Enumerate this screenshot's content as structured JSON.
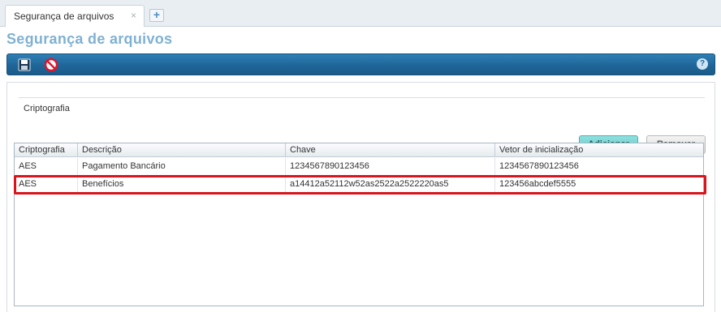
{
  "tabs": [
    {
      "label": "Segurança de arquivos",
      "close": "×"
    }
  ],
  "tab_add_label": "+",
  "page_title": "Segurança de arquivos",
  "toolbar": {
    "save_icon": "save-icon",
    "cancel_icon": "cancel-icon",
    "help_label": "?"
  },
  "section": {
    "legend": "Criptografia"
  },
  "buttons": {
    "add": "Adicionar",
    "remove": "Remover"
  },
  "table": {
    "columns": [
      "Criptografia",
      "Descrição",
      "Chave",
      "Vetor de inicialização"
    ],
    "rows": [
      [
        "AES",
        "Pagamento Bancário",
        "1234567890123456",
        "1234567890123456"
      ],
      [
        "AES",
        "Benefícios",
        "a14412a52112w52as2522a2522220as5",
        "123456abcdef5555"
      ]
    ],
    "highlighted_row": 1
  },
  "colors": {
    "toolbar": "#1f6698",
    "title": "#7fb1d3",
    "add_button": "#5ec6c5",
    "highlight": "#d9141b"
  }
}
